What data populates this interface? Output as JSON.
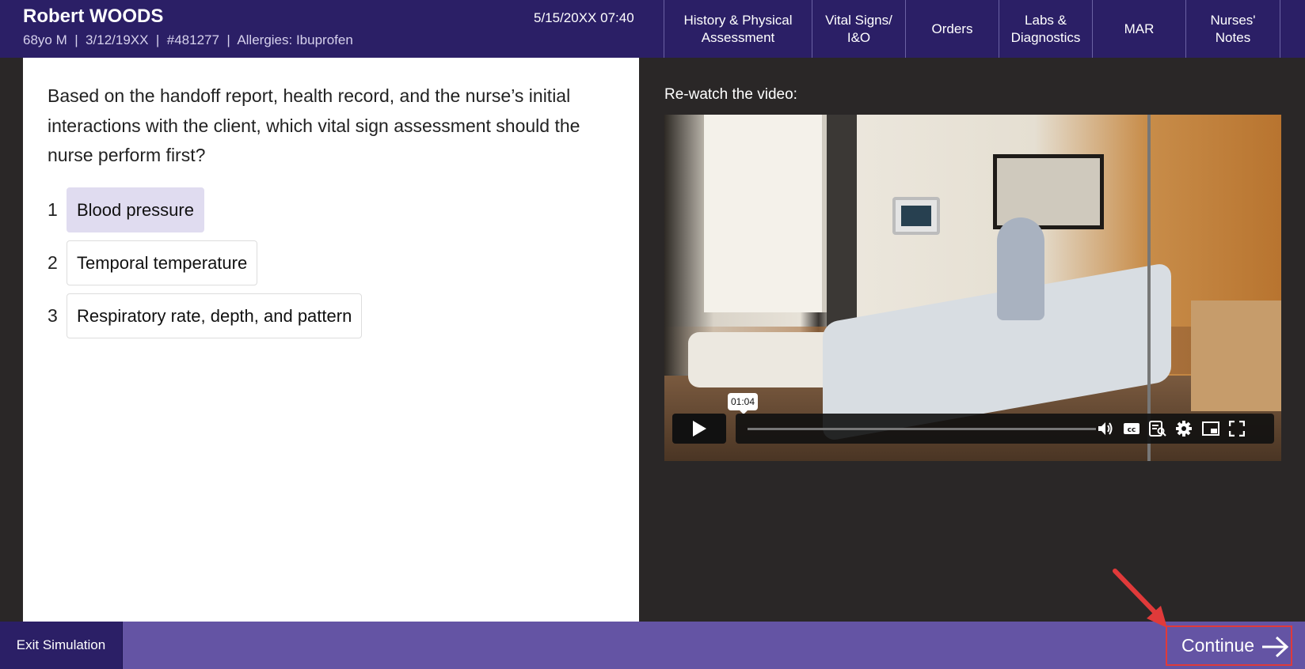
{
  "header": {
    "patient_name": "Robert WOODS",
    "patient_info": "68yo M  |  3/12/19XX  |  #481277  |  Allergies: Ibuprofen",
    "datetime": "5/15/20XX 07:40",
    "tabs": [
      {
        "label": "History & Physical\nAssessment"
      },
      {
        "label": "Vital Signs/\nI&O"
      },
      {
        "label": "Orders"
      },
      {
        "label": "Labs &\nDiagnostics"
      },
      {
        "label": "MAR"
      },
      {
        "label": "Nurses'\nNotes"
      }
    ]
  },
  "question": {
    "text": "Based on the handoff report, health record, and the nurse’s initial interactions with the client, which vital sign assessment should the nurse perform first?",
    "options": [
      {
        "number": "1",
        "label": "Blood pressure",
        "selected": true
      },
      {
        "number": "2",
        "label": "Temporal temperature",
        "selected": false
      },
      {
        "number": "3",
        "label": "Respiratory rate, depth, and pattern",
        "selected": false
      }
    ]
  },
  "video": {
    "label": "Re-watch the video:",
    "time_tooltip": "01:04",
    "icons": [
      "play-icon",
      "volume-icon",
      "cc-icon",
      "transcript-icon",
      "settings-icon",
      "pip-icon",
      "fullscreen-icon"
    ]
  },
  "footer": {
    "exit_label": "Exit Simulation",
    "continue_label": "Continue"
  },
  "colors": {
    "header_bg": "#2b1f66",
    "footer_bg": "#6454a4",
    "selected_option": "#e0dcf0",
    "annotation": "#e03a3a"
  }
}
